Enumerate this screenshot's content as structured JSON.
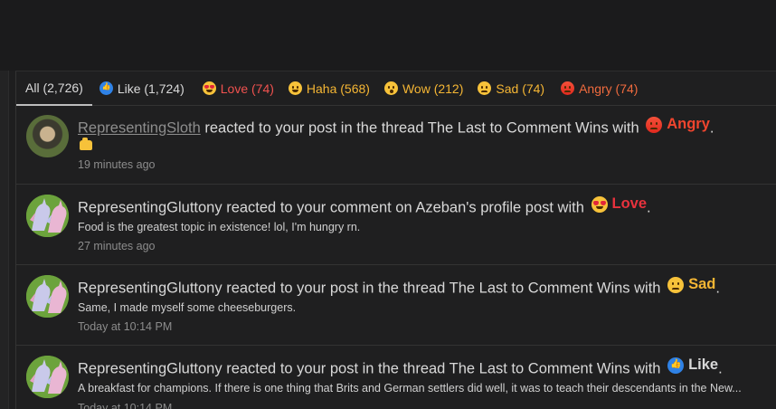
{
  "tabs": [
    {
      "label": "All (2,726)",
      "icon": "none"
    },
    {
      "label": "Like (1,724)",
      "icon": "like-icon"
    },
    {
      "label": "Love (74)",
      "icon": "love-icon"
    },
    {
      "label": "Haha (568)",
      "icon": "haha-icon"
    },
    {
      "label": "Wow (212)",
      "icon": "wow-icon"
    },
    {
      "label": "Sad (74)",
      "icon": "sad-icon"
    },
    {
      "label": "Angry (74)",
      "icon": "angry-icon"
    }
  ],
  "colors": {
    "love": "#e8323d",
    "angry": "#f0452e",
    "yellow": "#f5b634",
    "like": "#2f82e6"
  },
  "alerts": [
    {
      "user": "RepresentingSloth",
      "action": "reacted to your post in the thread The Last to Comment Wins with",
      "reaction": "Angry",
      "period": ".",
      "snippet": "",
      "time": "19 minutes ago",
      "avatar": "avatar-image"
    },
    {
      "user": "RepresentingGluttony",
      "action": "reacted to your comment on Azeban's profile post with",
      "reaction": "Love",
      "period": ".",
      "snippet": "Food is the greatest topic in existence! lol, I'm hungry rn.",
      "time": "27 minutes ago",
      "avatar": "unicorn-avatar"
    },
    {
      "user": "RepresentingGluttony",
      "action": "reacted to your post in the thread The Last to Comment Wins with",
      "reaction": "Sad",
      "period": ".",
      "snippet": "Same, I made myself some cheeseburgers.",
      "time": "Today at 10:14 PM",
      "avatar": "unicorn-avatar"
    },
    {
      "user": "RepresentingGluttony",
      "action": "reacted to your post in the thread The Last to Comment Wins with",
      "reaction": "Like",
      "period": ".",
      "snippet": "A breakfast for champions. If there is one thing that Brits and German settlers did well, it was to teach their descendants in the New...",
      "time": "Today at 10:14 PM",
      "avatar": "unicorn-avatar"
    }
  ]
}
